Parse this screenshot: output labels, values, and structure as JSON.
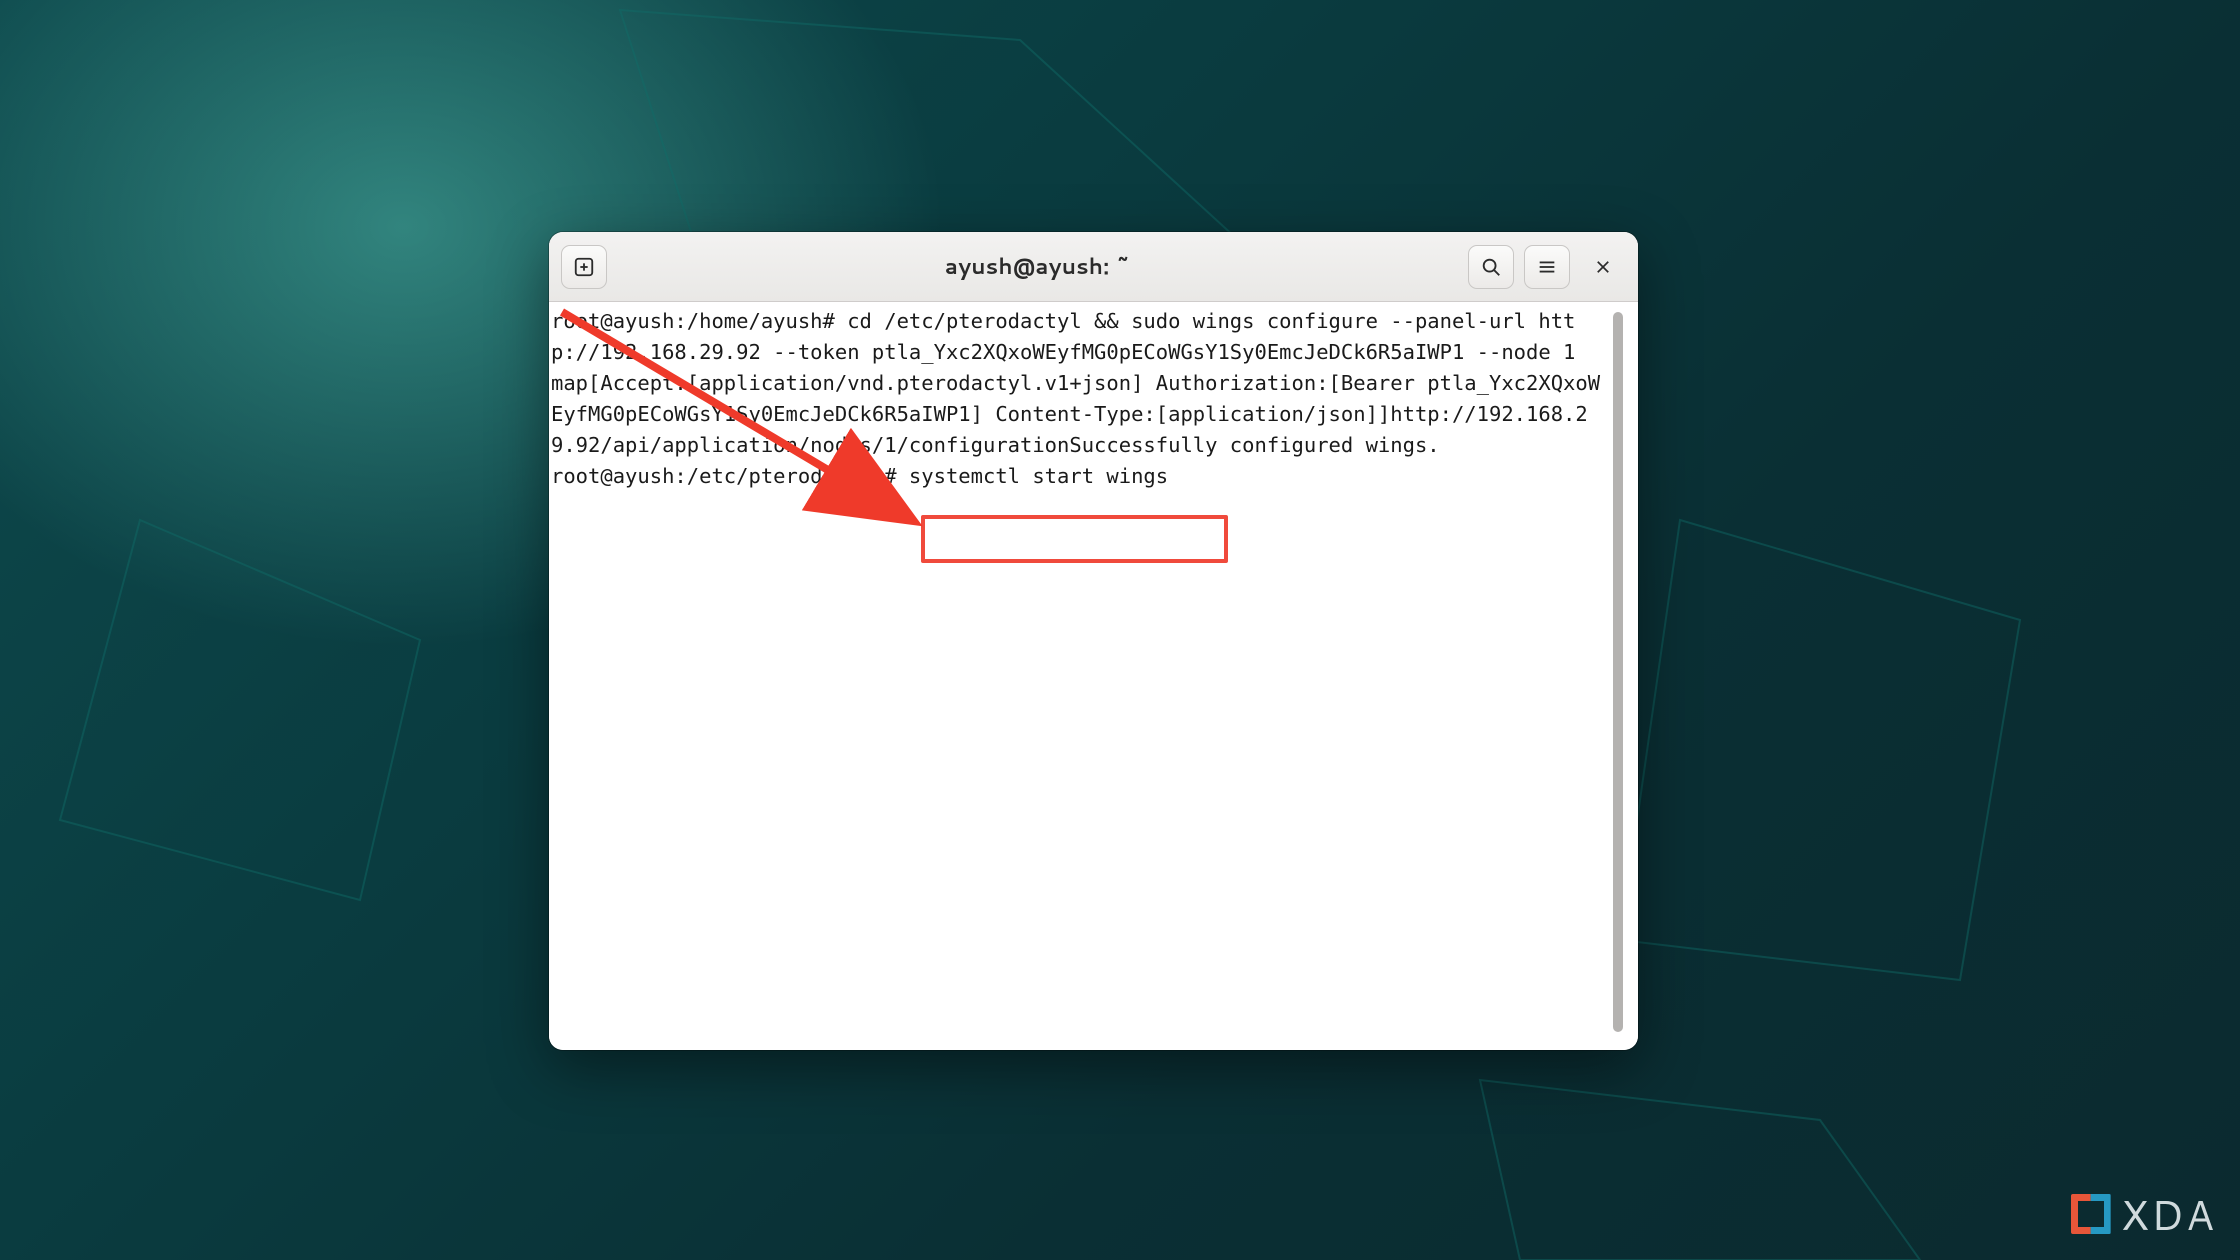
{
  "window": {
    "title": "ayush@ayush: ~"
  },
  "icons": {
    "new_tab": "plus-square-icon",
    "search": "search-icon",
    "menu": "hamburger-icon",
    "close": "close-icon"
  },
  "terminal": {
    "lines": [
      "root@ayush:/home/ayush# cd /etc/pterodactyl && sudo wings configure --panel-url http://192.168.29.92 --token ptla_Yxc2XQxoWEyfMG0pECoWGsY1Sy0EmcJeDCk6R5aIWP1 --node 1",
      "map[Accept:[application/vnd.pterodactyl.v1+json] Authorization:[Bearer ptla_Yxc2XQxoWEyfMG0pECoWGsY1Sy0EmcJeDCk6R5aIWP1] Content-Type:[application/json]]http://192.168.29.92/api/application/nodes/1/configurationSuccessfully configured wings.",
      "root@ayush:/etc/pterodactyl# systemctl start wings"
    ],
    "highlighted_command": "systemctl start wings"
  },
  "annotation": {
    "box_color": "#f04a3c",
    "arrow_color": "#ef3a2a"
  },
  "watermark": {
    "text": "XDA"
  }
}
